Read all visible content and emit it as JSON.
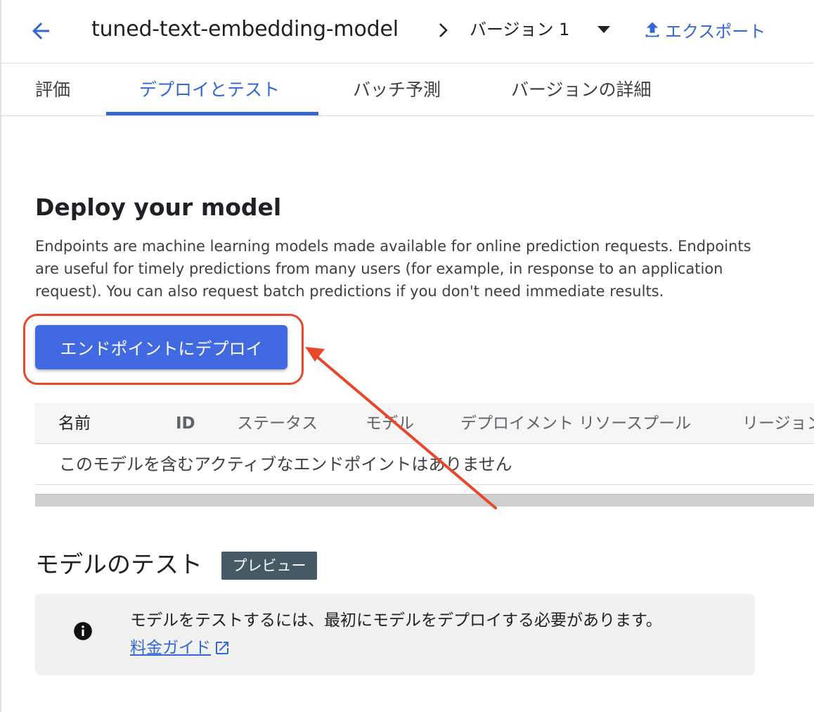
{
  "header": {
    "model_name": "tuned-text-embedding-model",
    "version_label": "バージョン 1",
    "export_label": "エクスポート"
  },
  "tabs": [
    {
      "label": "評価",
      "active": false
    },
    {
      "label": "デプロイとテスト",
      "active": true
    },
    {
      "label": "バッチ予測",
      "active": false
    },
    {
      "label": "バージョンの詳細",
      "active": false
    }
  ],
  "deploy": {
    "title": "Deploy your model",
    "description": "Endpoints are machine learning models made available for online prediction requests. Endpoints are useful for timely predictions from many users (for example, in response to an application request). You can also request batch predictions if you don't need immediate results.",
    "button_label": "エンドポイントにデプロイ"
  },
  "table": {
    "columns": [
      "名前",
      "ID",
      "ステータス",
      "モデル",
      "デプロイメント リソースプール",
      "リージョン"
    ],
    "empty_message": "このモデルを含むアクティブなエンドポイントはありません"
  },
  "test": {
    "title": "モデルのテスト",
    "badge": "プレビュー",
    "info_text": "モデルをテストするには、最初にモデルをデプロイする必要があります。",
    "pricing_link": "料金ガイド"
  },
  "colors": {
    "accent": "#3367d6",
    "button": "#4169e1",
    "annotation": "#e8472c",
    "badge": "#455a64"
  },
  "icons": [
    "arrow-back-icon",
    "chevron-right-icon",
    "dropdown-caret-icon",
    "upload-icon",
    "info-icon",
    "open-in-new-icon"
  ]
}
